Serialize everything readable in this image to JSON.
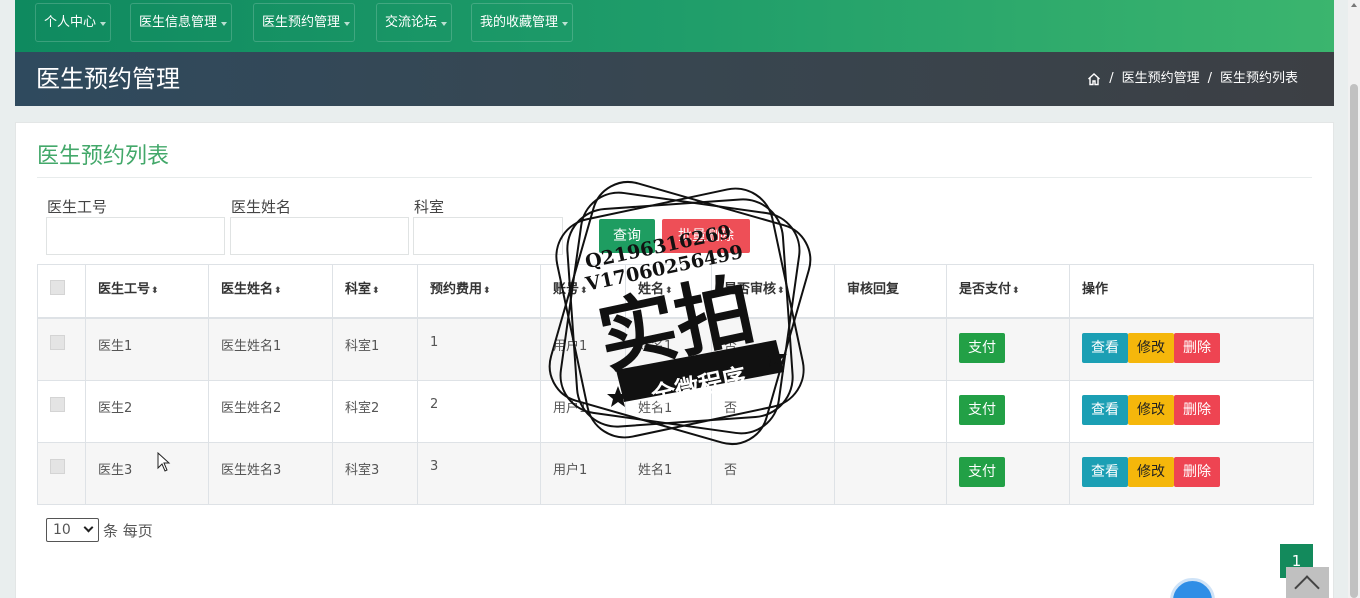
{
  "topnav": {
    "items": [
      {
        "label": "个人中心"
      },
      {
        "label": "医生信息管理"
      },
      {
        "label": "医生预约管理"
      },
      {
        "label": "交流论坛"
      },
      {
        "label": "我的收藏管理"
      }
    ]
  },
  "header": {
    "title": "医生预约管理",
    "breadcrumb": [
      "医生预约管理",
      "医生预约列表"
    ],
    "separator": "/"
  },
  "card": {
    "title": "医生预约列表",
    "filters": [
      {
        "label": "医生工号",
        "value": "",
        "placeholder": ""
      },
      {
        "label": "医生姓名",
        "value": "",
        "placeholder": ""
      },
      {
        "label": "科室",
        "value": "",
        "placeholder": ""
      }
    ],
    "search_label": "查询",
    "batch_delete_label": "批量删除"
  },
  "table": {
    "headers": [
      "医生工号",
      "医生姓名",
      "科室",
      "预约费用",
      "账号",
      "姓名",
      "是否审核",
      "审核回复",
      "是否支付",
      "操作"
    ],
    "rows": [
      [
        "医生1",
        "医生姓名1",
        "科室1",
        "1",
        "用户1",
        "姓名1",
        "否",
        "",
        ""
      ],
      [
        "医生2",
        "医生姓名2",
        "科室2",
        "2",
        "用户1",
        "姓名1",
        "否",
        "",
        ""
      ],
      [
        "医生3",
        "医生姓名3",
        "科室3",
        "3",
        "用户1",
        "姓名1",
        "否",
        "",
        ""
      ]
    ],
    "pay_label": "支付",
    "view_label": "查看",
    "edit_label": "修改",
    "delete_label": "删除"
  },
  "pagination": {
    "page_size": "10",
    "per_page_label": "条 每页",
    "current_page": "1"
  },
  "watermark": {
    "line1": "Q2196316269",
    "line2": "V17060256499",
    "main": "实拍",
    "ribbon": "全微程序"
  },
  "colors": {
    "nav_green": "#1f9d6a",
    "title_green": "#43a86a",
    "pay_green": "#22a046",
    "view_teal": "#1b9fb4",
    "edit_yellow": "#f5b70b",
    "delete_red": "#ee4452",
    "page_green": "#138a5c"
  }
}
